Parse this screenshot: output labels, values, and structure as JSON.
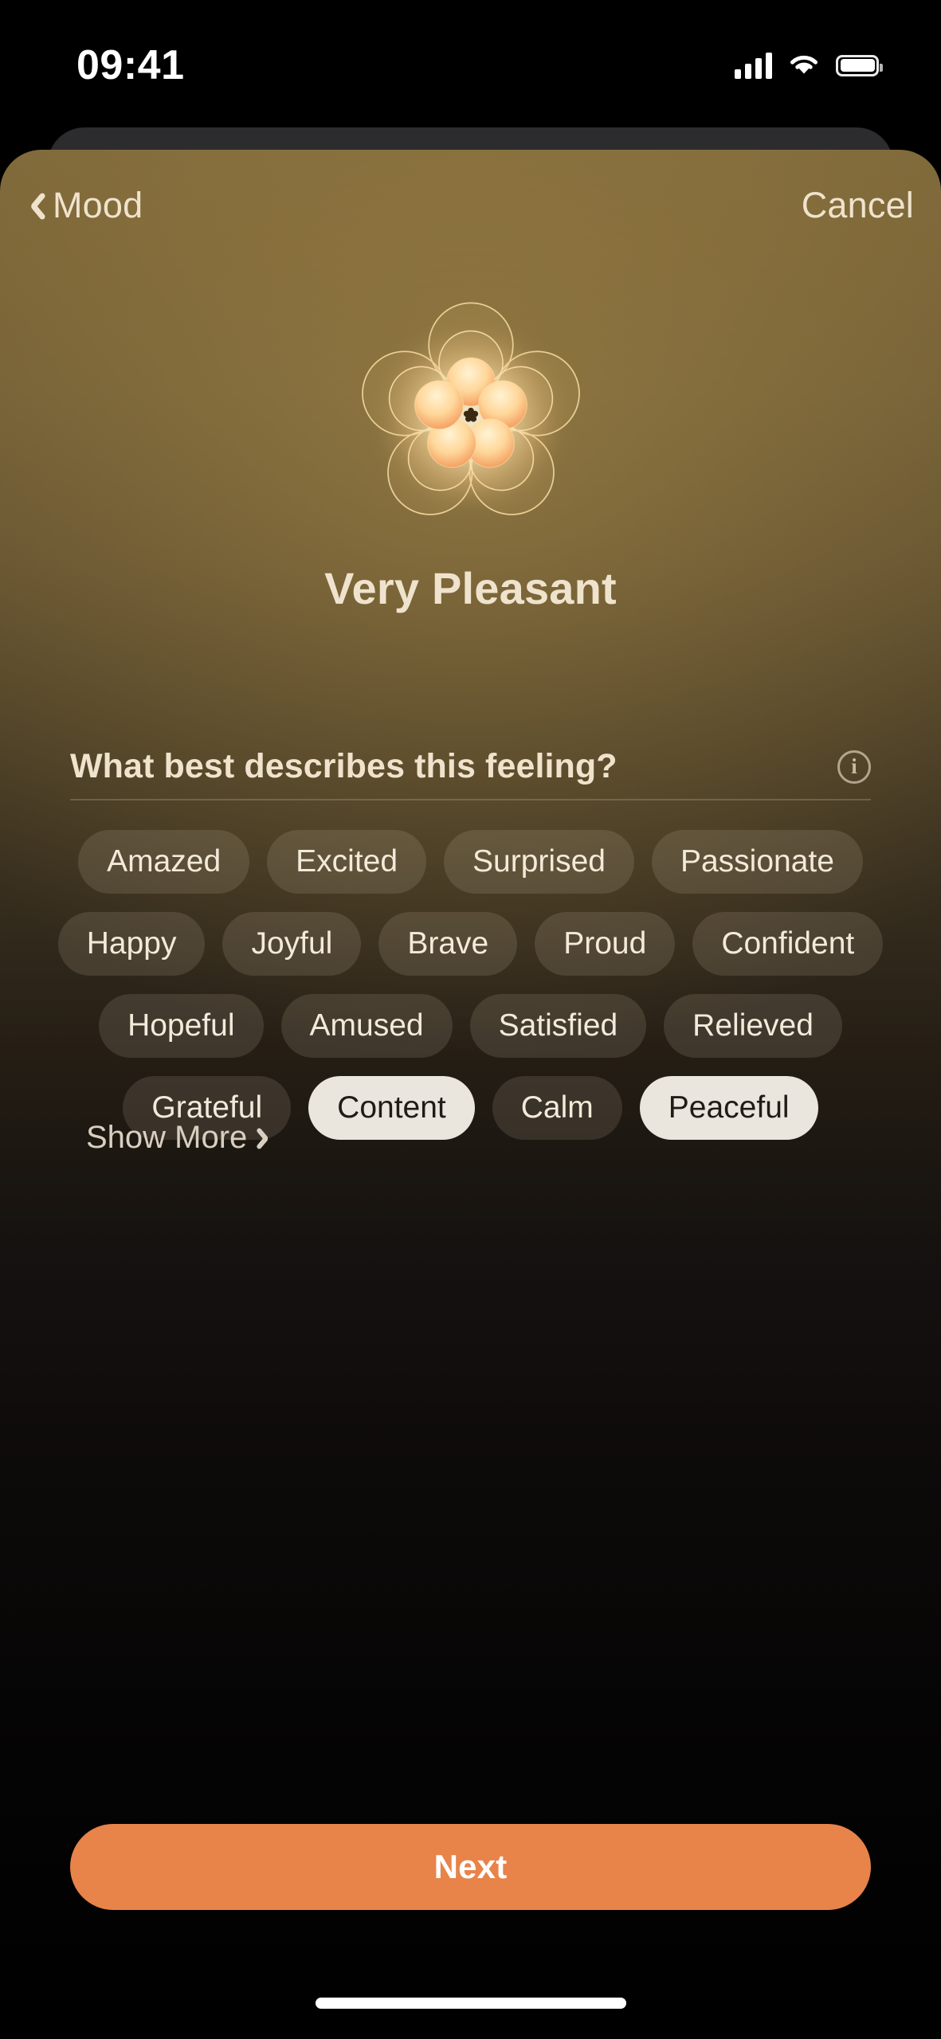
{
  "status_bar": {
    "time": "09:41",
    "cellular_icon": "cellular-bars-icon",
    "wifi_icon": "wifi-icon",
    "battery_icon": "battery-icon"
  },
  "nav": {
    "back_icon": "chevron-left-icon",
    "back_label": "Mood",
    "cancel_label": "Cancel"
  },
  "mood": {
    "graphic_icon": "flower-mood-icon",
    "title": "Very Pleasant"
  },
  "question": {
    "text": "What best describes this feeling?",
    "info_icon": "info-circle-icon",
    "info_glyph": "i"
  },
  "chips": {
    "rows": [
      [
        {
          "label": "Amazed",
          "selected": false
        },
        {
          "label": "Excited",
          "selected": false
        },
        {
          "label": "Surprised",
          "selected": false
        },
        {
          "label": "Passionate",
          "selected": false
        }
      ],
      [
        {
          "label": "Happy",
          "selected": false
        },
        {
          "label": "Joyful",
          "selected": false
        },
        {
          "label": "Brave",
          "selected": false
        },
        {
          "label": "Proud",
          "selected": false
        },
        {
          "label": "Confident",
          "selected": false
        }
      ],
      [
        {
          "label": "Hopeful",
          "selected": false
        },
        {
          "label": "Amused",
          "selected": false
        },
        {
          "label": "Satisfied",
          "selected": false
        },
        {
          "label": "Relieved",
          "selected": false
        }
      ],
      [
        {
          "label": "Grateful",
          "selected": false
        },
        {
          "label": "Content",
          "selected": true
        },
        {
          "label": "Calm",
          "selected": false
        },
        {
          "label": "Peaceful",
          "selected": true
        }
      ]
    ],
    "selected": [
      "Content",
      "Peaceful"
    ]
  },
  "show_more": {
    "label": "Show More",
    "icon": "chevron-right-icon"
  },
  "primary_action": {
    "label": "Next"
  },
  "colors": {
    "accent_orange": "#E8834A",
    "sheet_top_brown": "#7C6639",
    "sheet_bottom": "#000000",
    "text_cream": "#EFE3CD",
    "chip_unselected_bg": "rgba(238,226,198,0.13)",
    "chip_selected_bg": "#EAE5DD",
    "chip_selected_text": "#1F1C18"
  }
}
